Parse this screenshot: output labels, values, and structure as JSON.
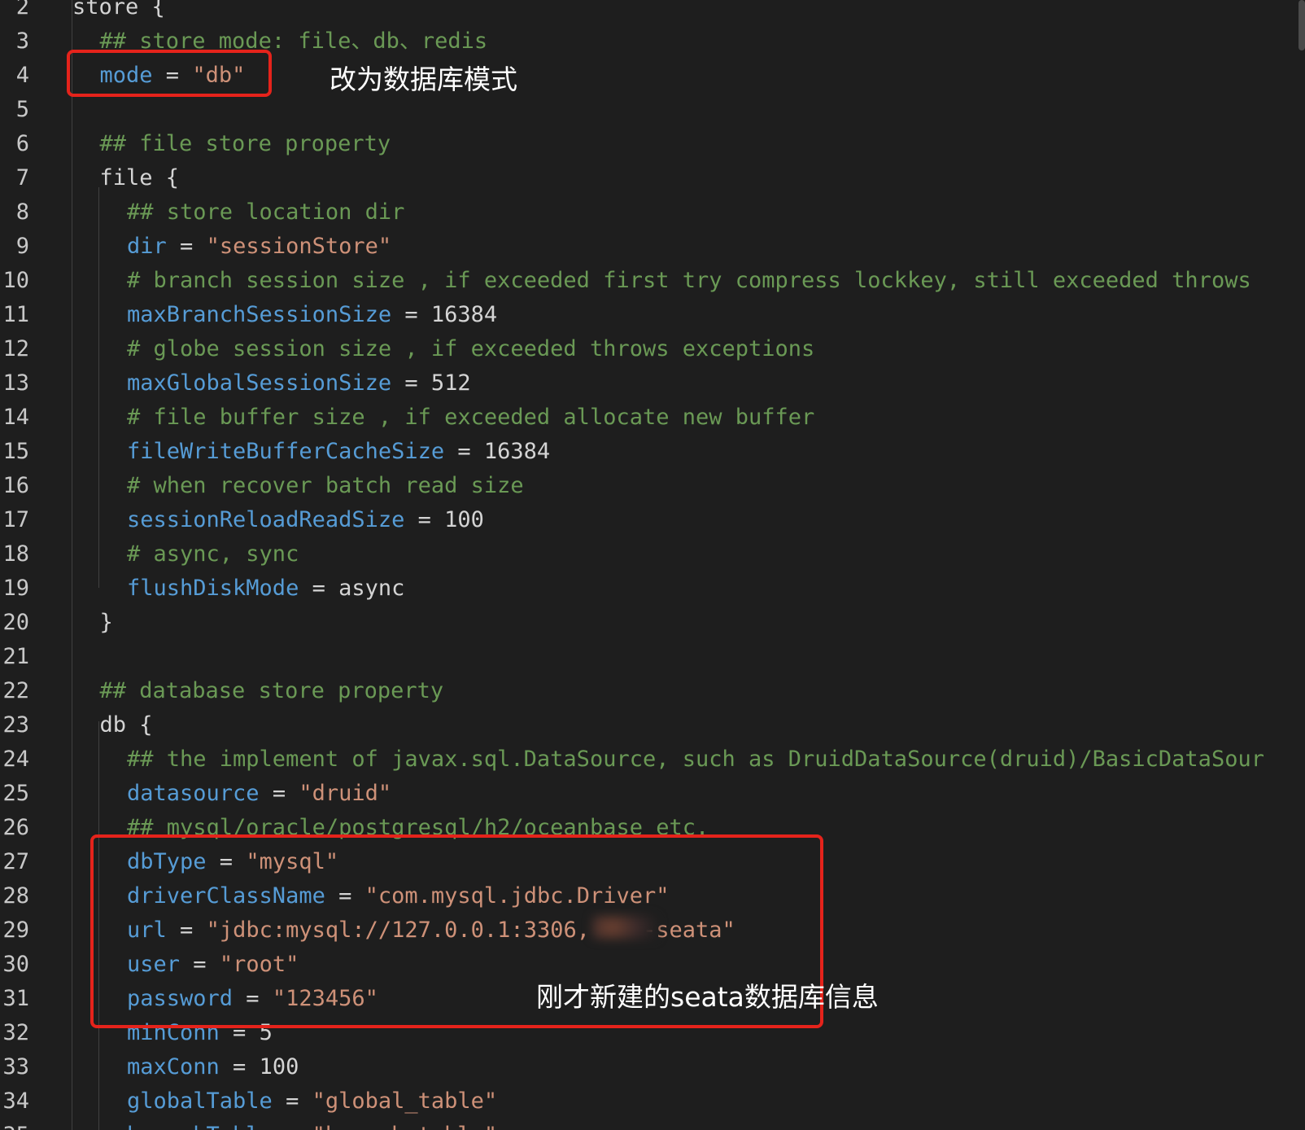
{
  "lines": [
    {
      "n": "2",
      "indent": 0,
      "tokens": [
        {
          "t": "txt",
          "v": "store {"
        }
      ]
    },
    {
      "n": "3",
      "indent": 1,
      "tokens": [
        {
          "t": "com",
          "v": "## store mode: file、db、redis"
        }
      ]
    },
    {
      "n": "4",
      "indent": 1,
      "tokens": [
        {
          "t": "key",
          "v": "mode"
        },
        {
          "t": "txt",
          "v": " = "
        },
        {
          "t": "str",
          "v": "\"db\""
        }
      ]
    },
    {
      "n": "5",
      "indent": 1,
      "tokens": []
    },
    {
      "n": "6",
      "indent": 1,
      "tokens": [
        {
          "t": "com",
          "v": "## file store property"
        }
      ]
    },
    {
      "n": "7",
      "indent": 1,
      "tokens": [
        {
          "t": "txt",
          "v": "file {"
        }
      ]
    },
    {
      "n": "8",
      "indent": 2,
      "tokens": [
        {
          "t": "com",
          "v": "## store location dir"
        }
      ]
    },
    {
      "n": "9",
      "indent": 2,
      "tokens": [
        {
          "t": "key",
          "v": "dir"
        },
        {
          "t": "txt",
          "v": " = "
        },
        {
          "t": "str",
          "v": "\"sessionStore\""
        }
      ]
    },
    {
      "n": "10",
      "indent": 2,
      "tokens": [
        {
          "t": "com",
          "v": "# branch session size , if exceeded first try compress lockkey, still exceeded throws"
        }
      ]
    },
    {
      "n": "11",
      "indent": 2,
      "tokens": [
        {
          "t": "key",
          "v": "maxBranchSessionSize"
        },
        {
          "t": "txt",
          "v": " = 16384"
        }
      ]
    },
    {
      "n": "12",
      "indent": 2,
      "tokens": [
        {
          "t": "com",
          "v": "# globe session size , if exceeded throws exceptions"
        }
      ]
    },
    {
      "n": "13",
      "indent": 2,
      "tokens": [
        {
          "t": "key",
          "v": "maxGlobalSessionSize"
        },
        {
          "t": "txt",
          "v": " = 512"
        }
      ]
    },
    {
      "n": "14",
      "indent": 2,
      "tokens": [
        {
          "t": "com",
          "v": "# file buffer size , if exceeded allocate new buffer"
        }
      ]
    },
    {
      "n": "15",
      "indent": 2,
      "tokens": [
        {
          "t": "key",
          "v": "fileWriteBufferCacheSize"
        },
        {
          "t": "txt",
          "v": " = 16384"
        }
      ]
    },
    {
      "n": "16",
      "indent": 2,
      "tokens": [
        {
          "t": "com",
          "v": "# when recover batch read size"
        }
      ]
    },
    {
      "n": "17",
      "indent": 2,
      "tokens": [
        {
          "t": "key",
          "v": "sessionReloadReadSize"
        },
        {
          "t": "txt",
          "v": " = 100"
        }
      ]
    },
    {
      "n": "18",
      "indent": 2,
      "tokens": [
        {
          "t": "com",
          "v": "# async, sync"
        }
      ]
    },
    {
      "n": "19",
      "indent": 2,
      "tokens": [
        {
          "t": "key",
          "v": "flushDiskMode"
        },
        {
          "t": "txt",
          "v": " = async"
        }
      ]
    },
    {
      "n": "20",
      "indent": 1,
      "tokens": [
        {
          "t": "txt",
          "v": "}"
        }
      ]
    },
    {
      "n": "21",
      "indent": 1,
      "tokens": []
    },
    {
      "n": "22",
      "indent": 1,
      "tokens": [
        {
          "t": "com",
          "v": "## database store property"
        }
      ]
    },
    {
      "n": "23",
      "indent": 1,
      "tokens": [
        {
          "t": "txt",
          "v": "db {"
        }
      ]
    },
    {
      "n": "24",
      "indent": 2,
      "tokens": [
        {
          "t": "com",
          "v": "## the implement of javax.sql.DataSource, such as DruidDataSource(druid)/BasicDataSour"
        }
      ]
    },
    {
      "n": "25",
      "indent": 2,
      "tokens": [
        {
          "t": "key",
          "v": "datasource"
        },
        {
          "t": "txt",
          "v": " = "
        },
        {
          "t": "str",
          "v": "\"druid\""
        }
      ]
    },
    {
      "n": "26",
      "indent": 2,
      "tokens": [
        {
          "t": "com",
          "v": "## mysql/oracle/postgresql/h2/oceanbase etc."
        }
      ]
    },
    {
      "n": "27",
      "indent": 2,
      "tokens": [
        {
          "t": "key",
          "v": "dbType"
        },
        {
          "t": "txt",
          "v": " = "
        },
        {
          "t": "str",
          "v": "\"mysql\""
        }
      ]
    },
    {
      "n": "28",
      "indent": 2,
      "tokens": [
        {
          "t": "key",
          "v": "driverClassName"
        },
        {
          "t": "txt",
          "v": " = "
        },
        {
          "t": "str",
          "v": "\"com.mysql.jdbc.Driver\""
        }
      ]
    },
    {
      "n": "29",
      "indent": 2,
      "tokens": [
        {
          "t": "key",
          "v": "url"
        },
        {
          "t": "txt",
          "v": " = "
        },
        {
          "t": "str",
          "v": "\"jdbc:mysql://127.0.0.1:3306,    -seata\""
        }
      ]
    },
    {
      "n": "30",
      "indent": 2,
      "tokens": [
        {
          "t": "key",
          "v": "user"
        },
        {
          "t": "txt",
          "v": " = "
        },
        {
          "t": "str",
          "v": "\"root\""
        }
      ]
    },
    {
      "n": "31",
      "indent": 2,
      "tokens": [
        {
          "t": "key",
          "v": "password"
        },
        {
          "t": "txt",
          "v": " = "
        },
        {
          "t": "str",
          "v": "\"123456\""
        }
      ]
    },
    {
      "n": "32",
      "indent": 2,
      "tokens": [
        {
          "t": "key",
          "v": "minConn"
        },
        {
          "t": "txt",
          "v": " = 5"
        }
      ]
    },
    {
      "n": "33",
      "indent": 2,
      "tokens": [
        {
          "t": "key",
          "v": "maxConn"
        },
        {
          "t": "txt",
          "v": " = 100"
        }
      ]
    },
    {
      "n": "34",
      "indent": 2,
      "tokens": [
        {
          "t": "key",
          "v": "globalTable"
        },
        {
          "t": "txt",
          "v": " = "
        },
        {
          "t": "str",
          "v": "\"global_table\""
        }
      ]
    },
    {
      "n": "35",
      "indent": 2,
      "tokens": [
        {
          "t": "key",
          "v": "branchTable"
        },
        {
          "t": "txt",
          "v": " = "
        },
        {
          "t": "str",
          "v": "\"branch_table\""
        }
      ]
    }
  ],
  "annotations": {
    "mode_note": "改为数据库模式",
    "db_note": "刚才新建的seata数据库信息"
  },
  "colors": {
    "background": "#1e1e1e",
    "comment": "#6a9955",
    "keyword": "#569cd6",
    "string": "#ce9178",
    "text": "#d4d4d4",
    "highlight_box": "#e5231b"
  }
}
